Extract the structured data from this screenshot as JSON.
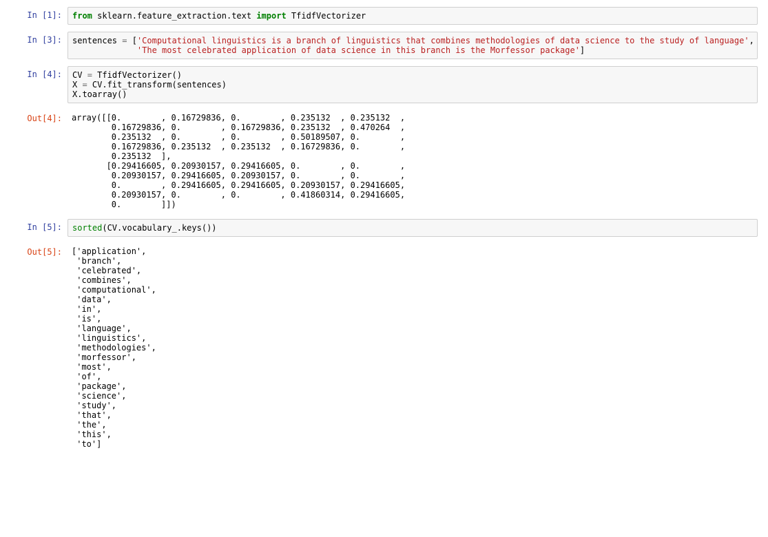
{
  "cells": {
    "c1": {
      "in_prompt": "In  [1]:",
      "code": {
        "kw_from": "from",
        "mod": " sklearn.feature_extraction.text ",
        "kw_import": "import",
        "cls": " TfidfVectorizer"
      }
    },
    "c3": {
      "in_prompt": "In  [3]:",
      "code": {
        "var": "sentences ",
        "op": "=",
        "open": " [",
        "s1": "'Computational linguistics is a branch of linguistics that combines methodologies of data science to the study of language'",
        "comma": ",",
        "indent": "\n             ",
        "s2": "'The most celebrated application of data science in this branch is the Morfessor package'",
        "close": "]"
      }
    },
    "c4": {
      "in_prompt": "In  [4]:",
      "out_prompt": "Out[4]:",
      "code": {
        "l1a": "CV ",
        "l1op": "=",
        "l1b": " TfidfVectorizer()",
        "l2a": "\nX ",
        "l2op": "=",
        "l2b": " CV.fit_transform(sentences)",
        "l3": "\nX.toarray()"
      },
      "out": "array([[0.        , 0.16729836, 0.        , 0.235132  , 0.235132  ,\n        0.16729836, 0.        , 0.16729836, 0.235132  , 0.470264  ,\n        0.235132  , 0.        , 0.        , 0.50189507, 0.        ,\n        0.16729836, 0.235132  , 0.235132  , 0.16729836, 0.        ,\n        0.235132  ],\n       [0.29416605, 0.20930157, 0.29416605, 0.        , 0.        ,\n        0.20930157, 0.29416605, 0.20930157, 0.        , 0.        ,\n        0.        , 0.29416605, 0.29416605, 0.20930157, 0.29416605,\n        0.20930157, 0.        , 0.        , 0.41860314, 0.29416605,\n        0.        ]])"
    },
    "c5": {
      "in_prompt": "In  [5]:",
      "out_prompt": "Out[5]:",
      "code": {
        "sorted": "sorted",
        "rest": "(CV.vocabulary_.keys())"
      },
      "out": "['application',\n 'branch',\n 'celebrated',\n 'combines',\n 'computational',\n 'data',\n 'in',\n 'is',\n 'language',\n 'linguistics',\n 'methodologies',\n 'morfessor',\n 'most',\n 'of',\n 'package',\n 'science',\n 'study',\n 'that',\n 'the',\n 'this',\n 'to']"
    }
  }
}
